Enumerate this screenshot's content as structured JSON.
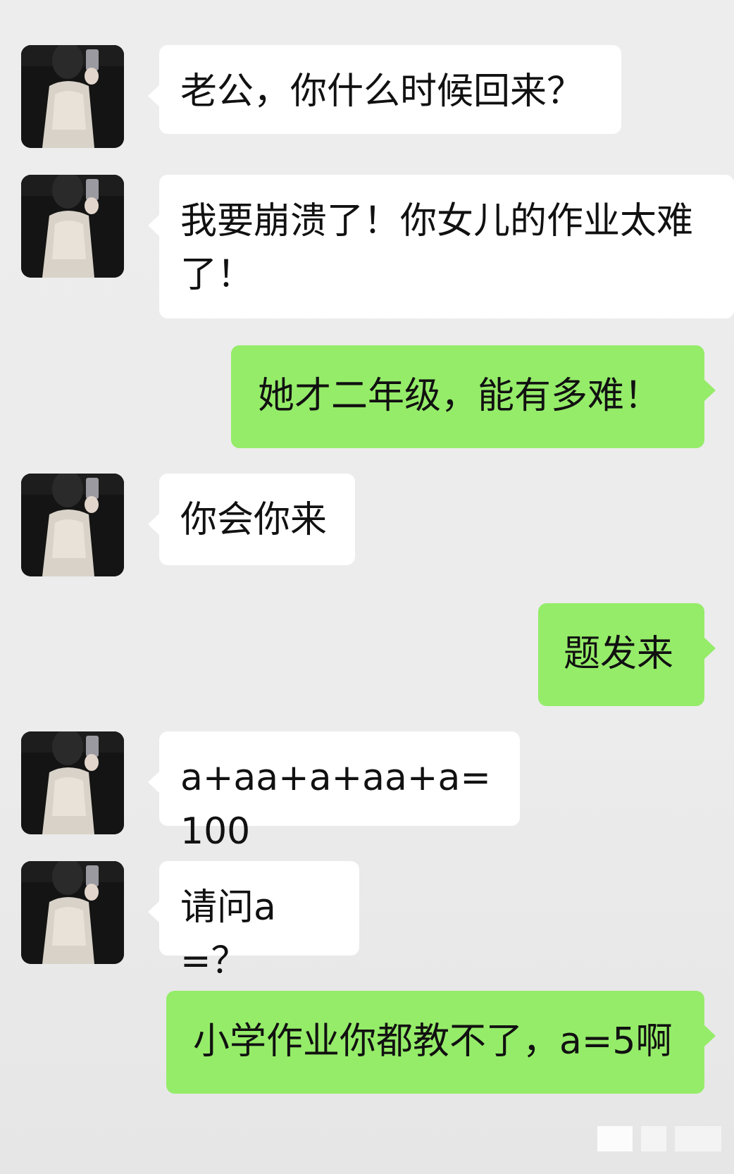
{
  "messages": [
    {
      "side": "in",
      "text": "老公，你什么时候回来？"
    },
    {
      "side": "in",
      "text": "我要崩溃了！你女儿的作业太难了！"
    },
    {
      "side": "out",
      "text": "她才二年级，能有多难！"
    },
    {
      "side": "in",
      "text": "你会你来"
    },
    {
      "side": "out",
      "text": "题发来"
    },
    {
      "side": "in",
      "text": "a+aa+a+aa+a=100"
    },
    {
      "side": "in",
      "text": "请问a=？"
    },
    {
      "side": "out",
      "text": "小学作业你都教不了，a=5啊"
    }
  ],
  "colors": {
    "background": "#ededed",
    "incoming_bubble": "#ffffff",
    "outgoing_bubble": "#95ec69",
    "text": "#111111"
  },
  "icons": {
    "avatar": "contact-avatar-photo"
  }
}
